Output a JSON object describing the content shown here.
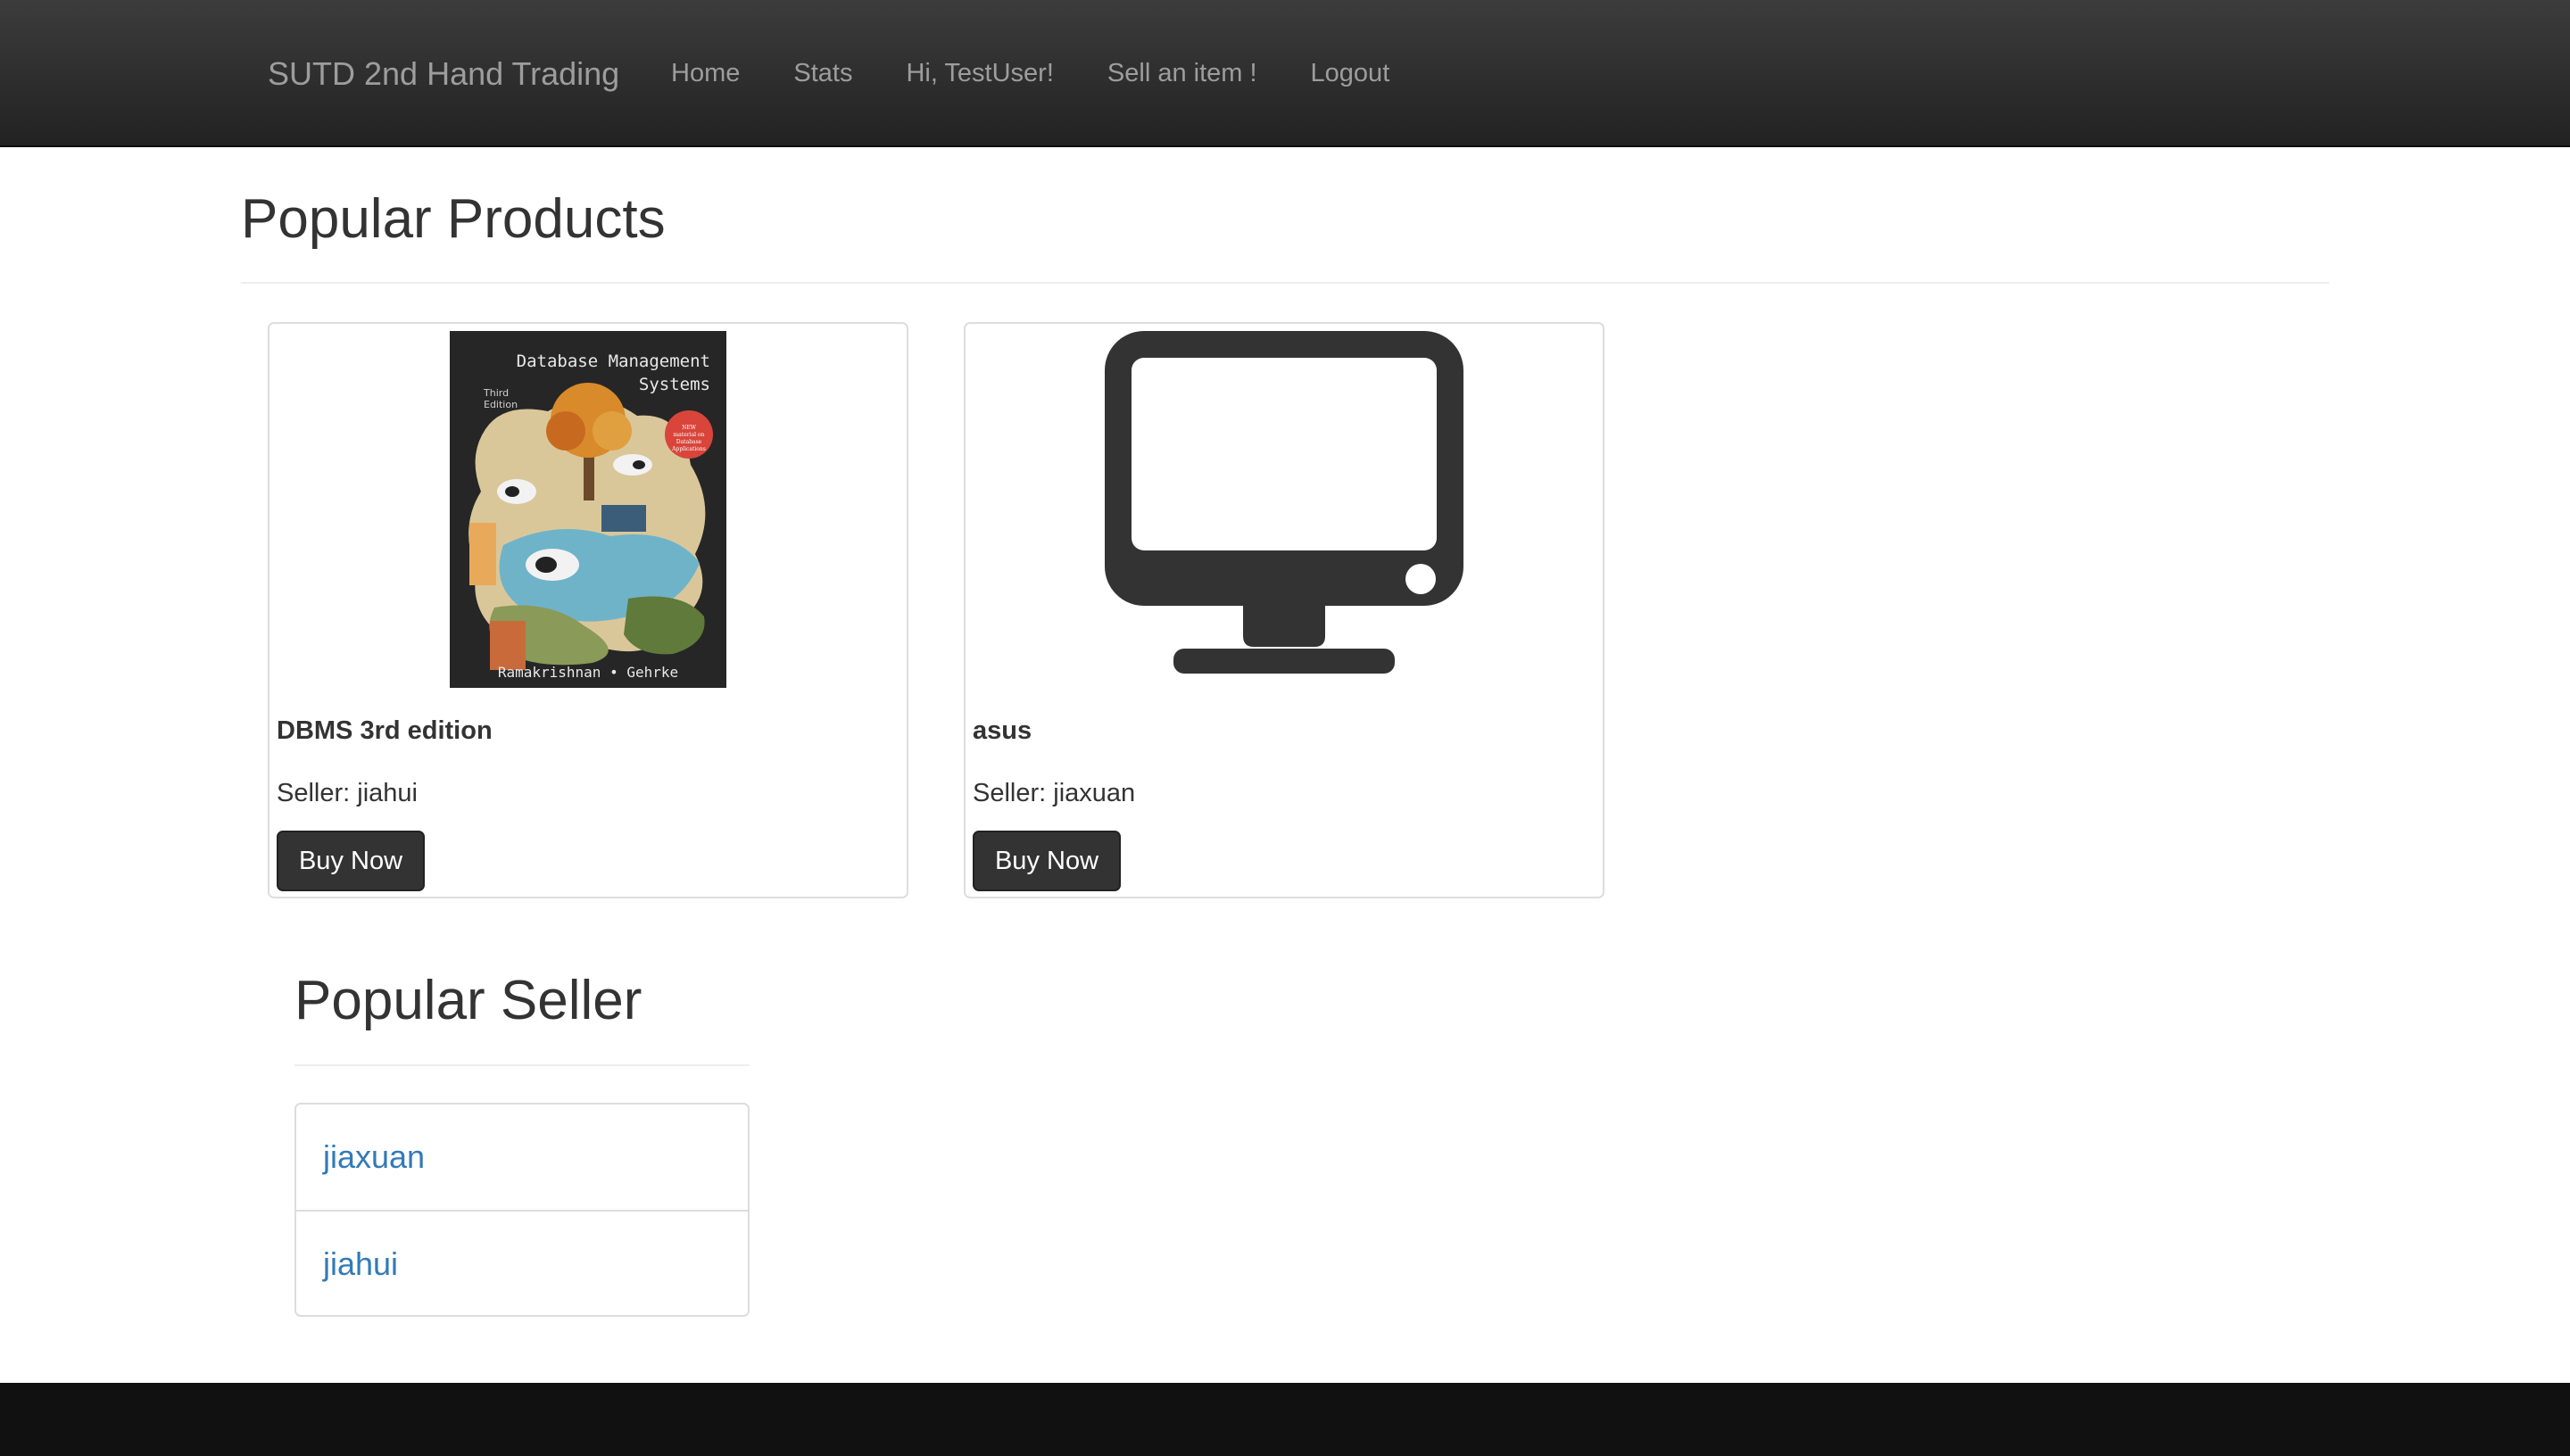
{
  "navbar": {
    "brand": "SUTD 2nd Hand Trading",
    "links": [
      {
        "label": "Home"
      },
      {
        "label": "Stats"
      },
      {
        "label": "Hi, TestUser!"
      },
      {
        "label": "Sell an item !"
      },
      {
        "label": "Logout"
      }
    ]
  },
  "popular_products": {
    "title": "Popular Products",
    "items": [
      {
        "name": "DBMS 3rd edition",
        "seller": "Seller: jiahui",
        "buy_label": "Buy Now",
        "image": {
          "type": "book-cover",
          "title": "Database Management Systems",
          "edition": "Third Edition",
          "badge": "NEW material on Database Applications",
          "authors": "Ramakrishnan • Gehrke"
        }
      },
      {
        "name": "asus",
        "seller": "Seller: jiaxuan",
        "buy_label": "Buy Now",
        "image": {
          "type": "monitor-icon"
        }
      }
    ]
  },
  "popular_seller": {
    "title": "Popular Seller",
    "items": [
      {
        "name": "jiaxuan"
      },
      {
        "name": "jiahui"
      }
    ]
  },
  "colors": {
    "navbar_bg": "#222222",
    "nav_text": "#9d9d9d",
    "button_bg": "#333333",
    "link": "#337ab7",
    "footer_bg": "#111111"
  }
}
